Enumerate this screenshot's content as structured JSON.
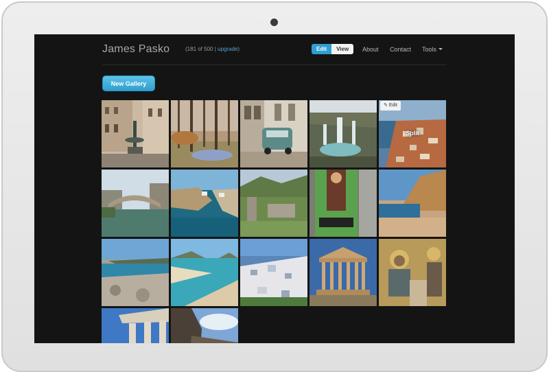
{
  "header": {
    "brand": "James Pasko",
    "quota_prefix": "(181 of 500 | ",
    "quota_link": "upgrade",
    "quota_suffix": ")"
  },
  "mode_toggle": {
    "edit_label": "Edit",
    "view_label": "View"
  },
  "nav": {
    "about": "About",
    "contact": "Contact",
    "tools": "Tools"
  },
  "actions": {
    "new_gallery": "New Gallery"
  },
  "gallery": {
    "hover_edit_label": "Edit",
    "tiles": [
      {
        "subject": "city-square-fountain"
      },
      {
        "subject": "autumn-forest"
      },
      {
        "subject": "vintage-car-street"
      },
      {
        "subject": "waterfalls"
      },
      {
        "subject": "coastal-old-town",
        "label": "Split"
      },
      {
        "subject": "old-stone-bridge"
      },
      {
        "subject": "blue-bay-cliffs"
      },
      {
        "subject": "ancient-ruins-hills"
      },
      {
        "subject": "mural-wall"
      },
      {
        "subject": "sandy-cove-cliffs"
      },
      {
        "subject": "rocky-shore"
      },
      {
        "subject": "turquoise-beach"
      },
      {
        "subject": "white-hillside-village"
      },
      {
        "subject": "parthenon"
      },
      {
        "subject": "mosaic-icon"
      },
      {
        "subject": "temple-columns"
      },
      {
        "subject": "cliff-rock-sky"
      }
    ]
  },
  "colors": {
    "accent": "#2f9fcf",
    "screen_bg": "#141414",
    "link": "#4fa3d6"
  }
}
